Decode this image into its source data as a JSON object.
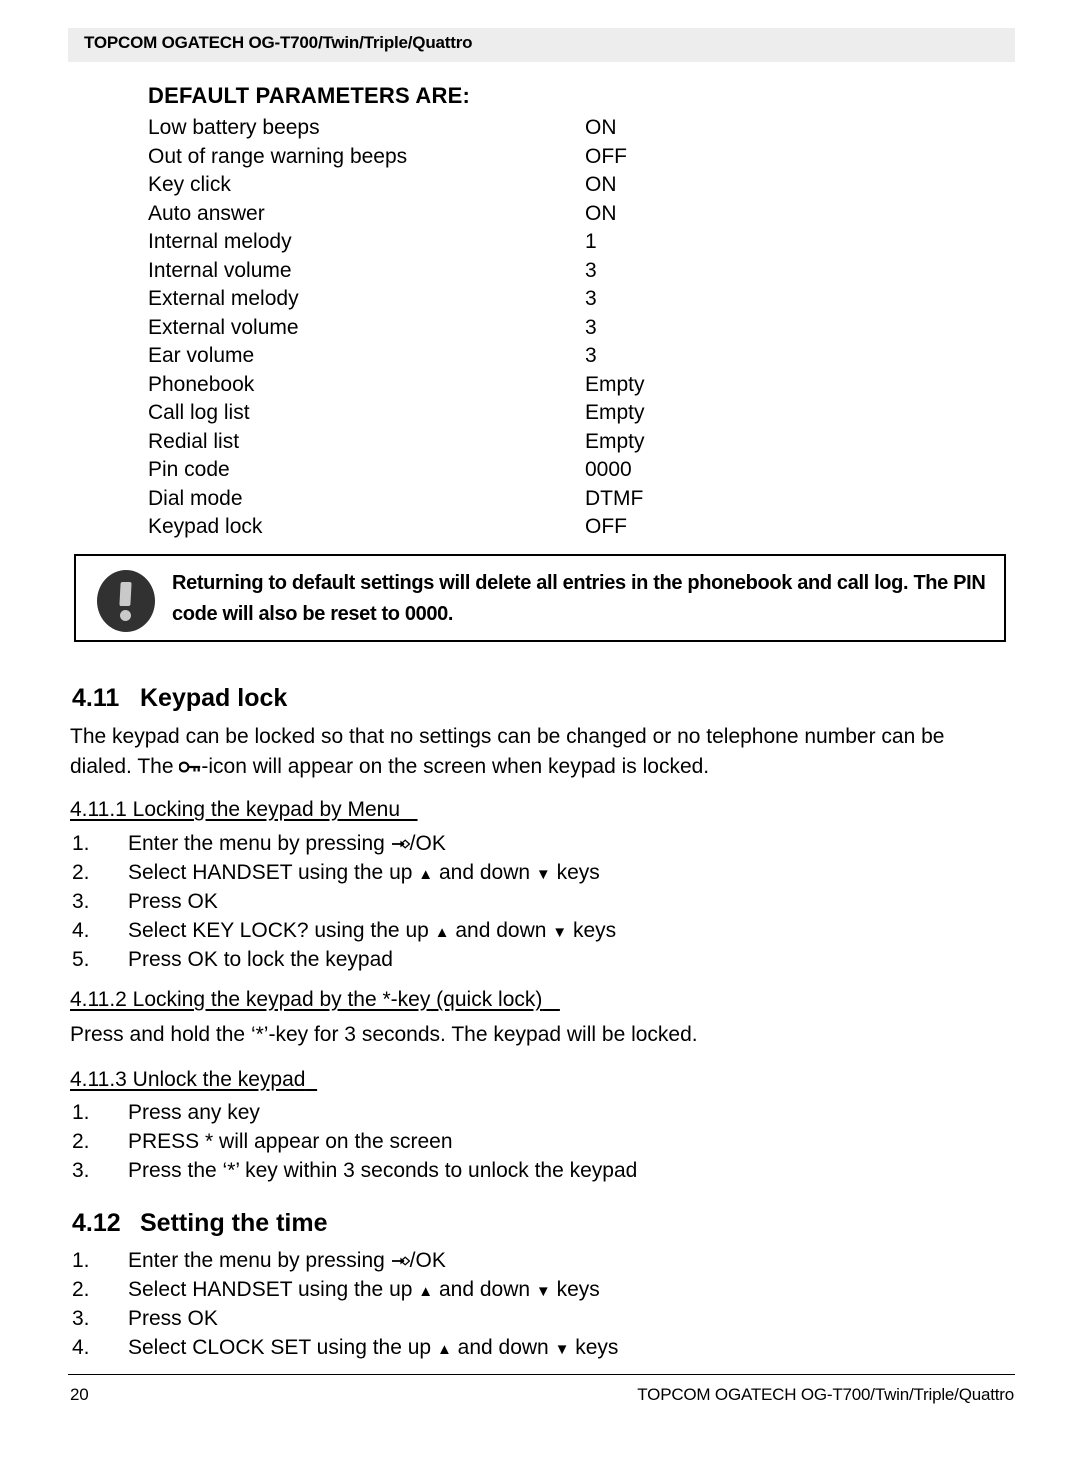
{
  "header": {
    "title": "TOPCOM OGATECH OG-T700/Twin/Triple/Quattro"
  },
  "defaults": {
    "title": "DEFAULT PARAMETERS ARE:",
    "rows": [
      {
        "label": "Low battery beeps",
        "value": "ON"
      },
      {
        "label": "Out of range warning beeps",
        "value": "OFF"
      },
      {
        "label": "Key click",
        "value": "ON"
      },
      {
        "label": "Auto answer",
        "value": "ON"
      },
      {
        "label": "Internal melody",
        "value": "1"
      },
      {
        "label": "Internal volume",
        "value": "3"
      },
      {
        "label": "External melody",
        "value": "3"
      },
      {
        "label": "External volume",
        "value": "3"
      },
      {
        "label": "Ear volume",
        "value": "3"
      },
      {
        "label": "Phonebook",
        "value": "Empty"
      },
      {
        "label": "Call log list",
        "value": "Empty"
      },
      {
        "label": "Redial list",
        "value": "Empty"
      },
      {
        "label": "Pin code",
        "value": "0000"
      },
      {
        "label": "Dial mode",
        "value": "DTMF"
      },
      {
        "label": "Keypad lock",
        "value": "OFF"
      }
    ]
  },
  "warning": {
    "icon": "exclamation-icon",
    "text": "Returning to default settings will delete all entries in the phonebook and call log. The PIN code will also be reset to 0000."
  },
  "section_411": {
    "number": "4.11",
    "title": "Keypad lock",
    "intro_part1": "The keypad can be locked so that no settings can be changed or no telephone number can be dialed. The ",
    "intro_icon": "key-icon",
    "intro_part2": "-icon will appear on the screen when keypad is locked.",
    "sub1": {
      "heading": "4.11.1 Locking the keypad by Menu",
      "items": [
        {
          "n": "1.",
          "pre": "Enter the menu by pressing ",
          "icon": "menu-ok-icon",
          "post": "/OK"
        },
        {
          "n": "2.",
          "pre": "Select HANDSET using the up ",
          "icon": "up-triangle-icon",
          "mid": " and down ",
          "icon2": "down-triangle-icon",
          "post": " keys"
        },
        {
          "n": "3.",
          "pre": "Press OK"
        },
        {
          "n": "4.",
          "pre": "Select KEY LOCK? using the up ",
          "icon": "up-triangle-icon",
          "mid": " and down ",
          "icon2": "down-triangle-icon",
          "post": " keys"
        },
        {
          "n": "5.",
          "pre": "Press OK to lock the keypad"
        }
      ]
    },
    "sub2": {
      "heading": "4.11.2 Locking the keypad by the *-key (quick lock)",
      "body": "Press and hold the ‘*’-key for 3 seconds. The keypad will be locked."
    },
    "sub3": {
      "heading": "4.11.3 Unlock the keypad",
      "items": [
        {
          "n": "1.",
          "pre": "Press any key"
        },
        {
          "n": "2.",
          "pre": "PRESS * will appear on the screen"
        },
        {
          "n": "3.",
          "pre": "Press the ‘*’ key within 3 seconds to unlock the keypad"
        }
      ]
    }
  },
  "section_412": {
    "number": "4.12",
    "title": "Setting the time",
    "items": [
      {
        "n": "1.",
        "pre": "Enter the menu by pressing ",
        "icon": "menu-ok-icon",
        "post": "/OK"
      },
      {
        "n": "2.",
        "pre": "Select HANDSET using the up ",
        "icon": "up-triangle-icon",
        "mid": " and down ",
        "icon2": "down-triangle-icon",
        "post": " keys"
      },
      {
        "n": "3.",
        "pre": "Press OK"
      },
      {
        "n": "4.",
        "pre": "Select CLOCK SET using the up ",
        "icon": "up-triangle-icon",
        "mid": " and down ",
        "icon2": "down-triangle-icon",
        "post": " keys"
      }
    ]
  },
  "footer": {
    "page_number": "20",
    "title": "TOPCOM OGATECH OG-T700/Twin/Triple/Quattro"
  },
  "colors": {
    "header_band": "#ededed",
    "warning_icon_bg": "#313131",
    "warning_icon_fg": "#c9c9c9",
    "text": "#000000"
  }
}
